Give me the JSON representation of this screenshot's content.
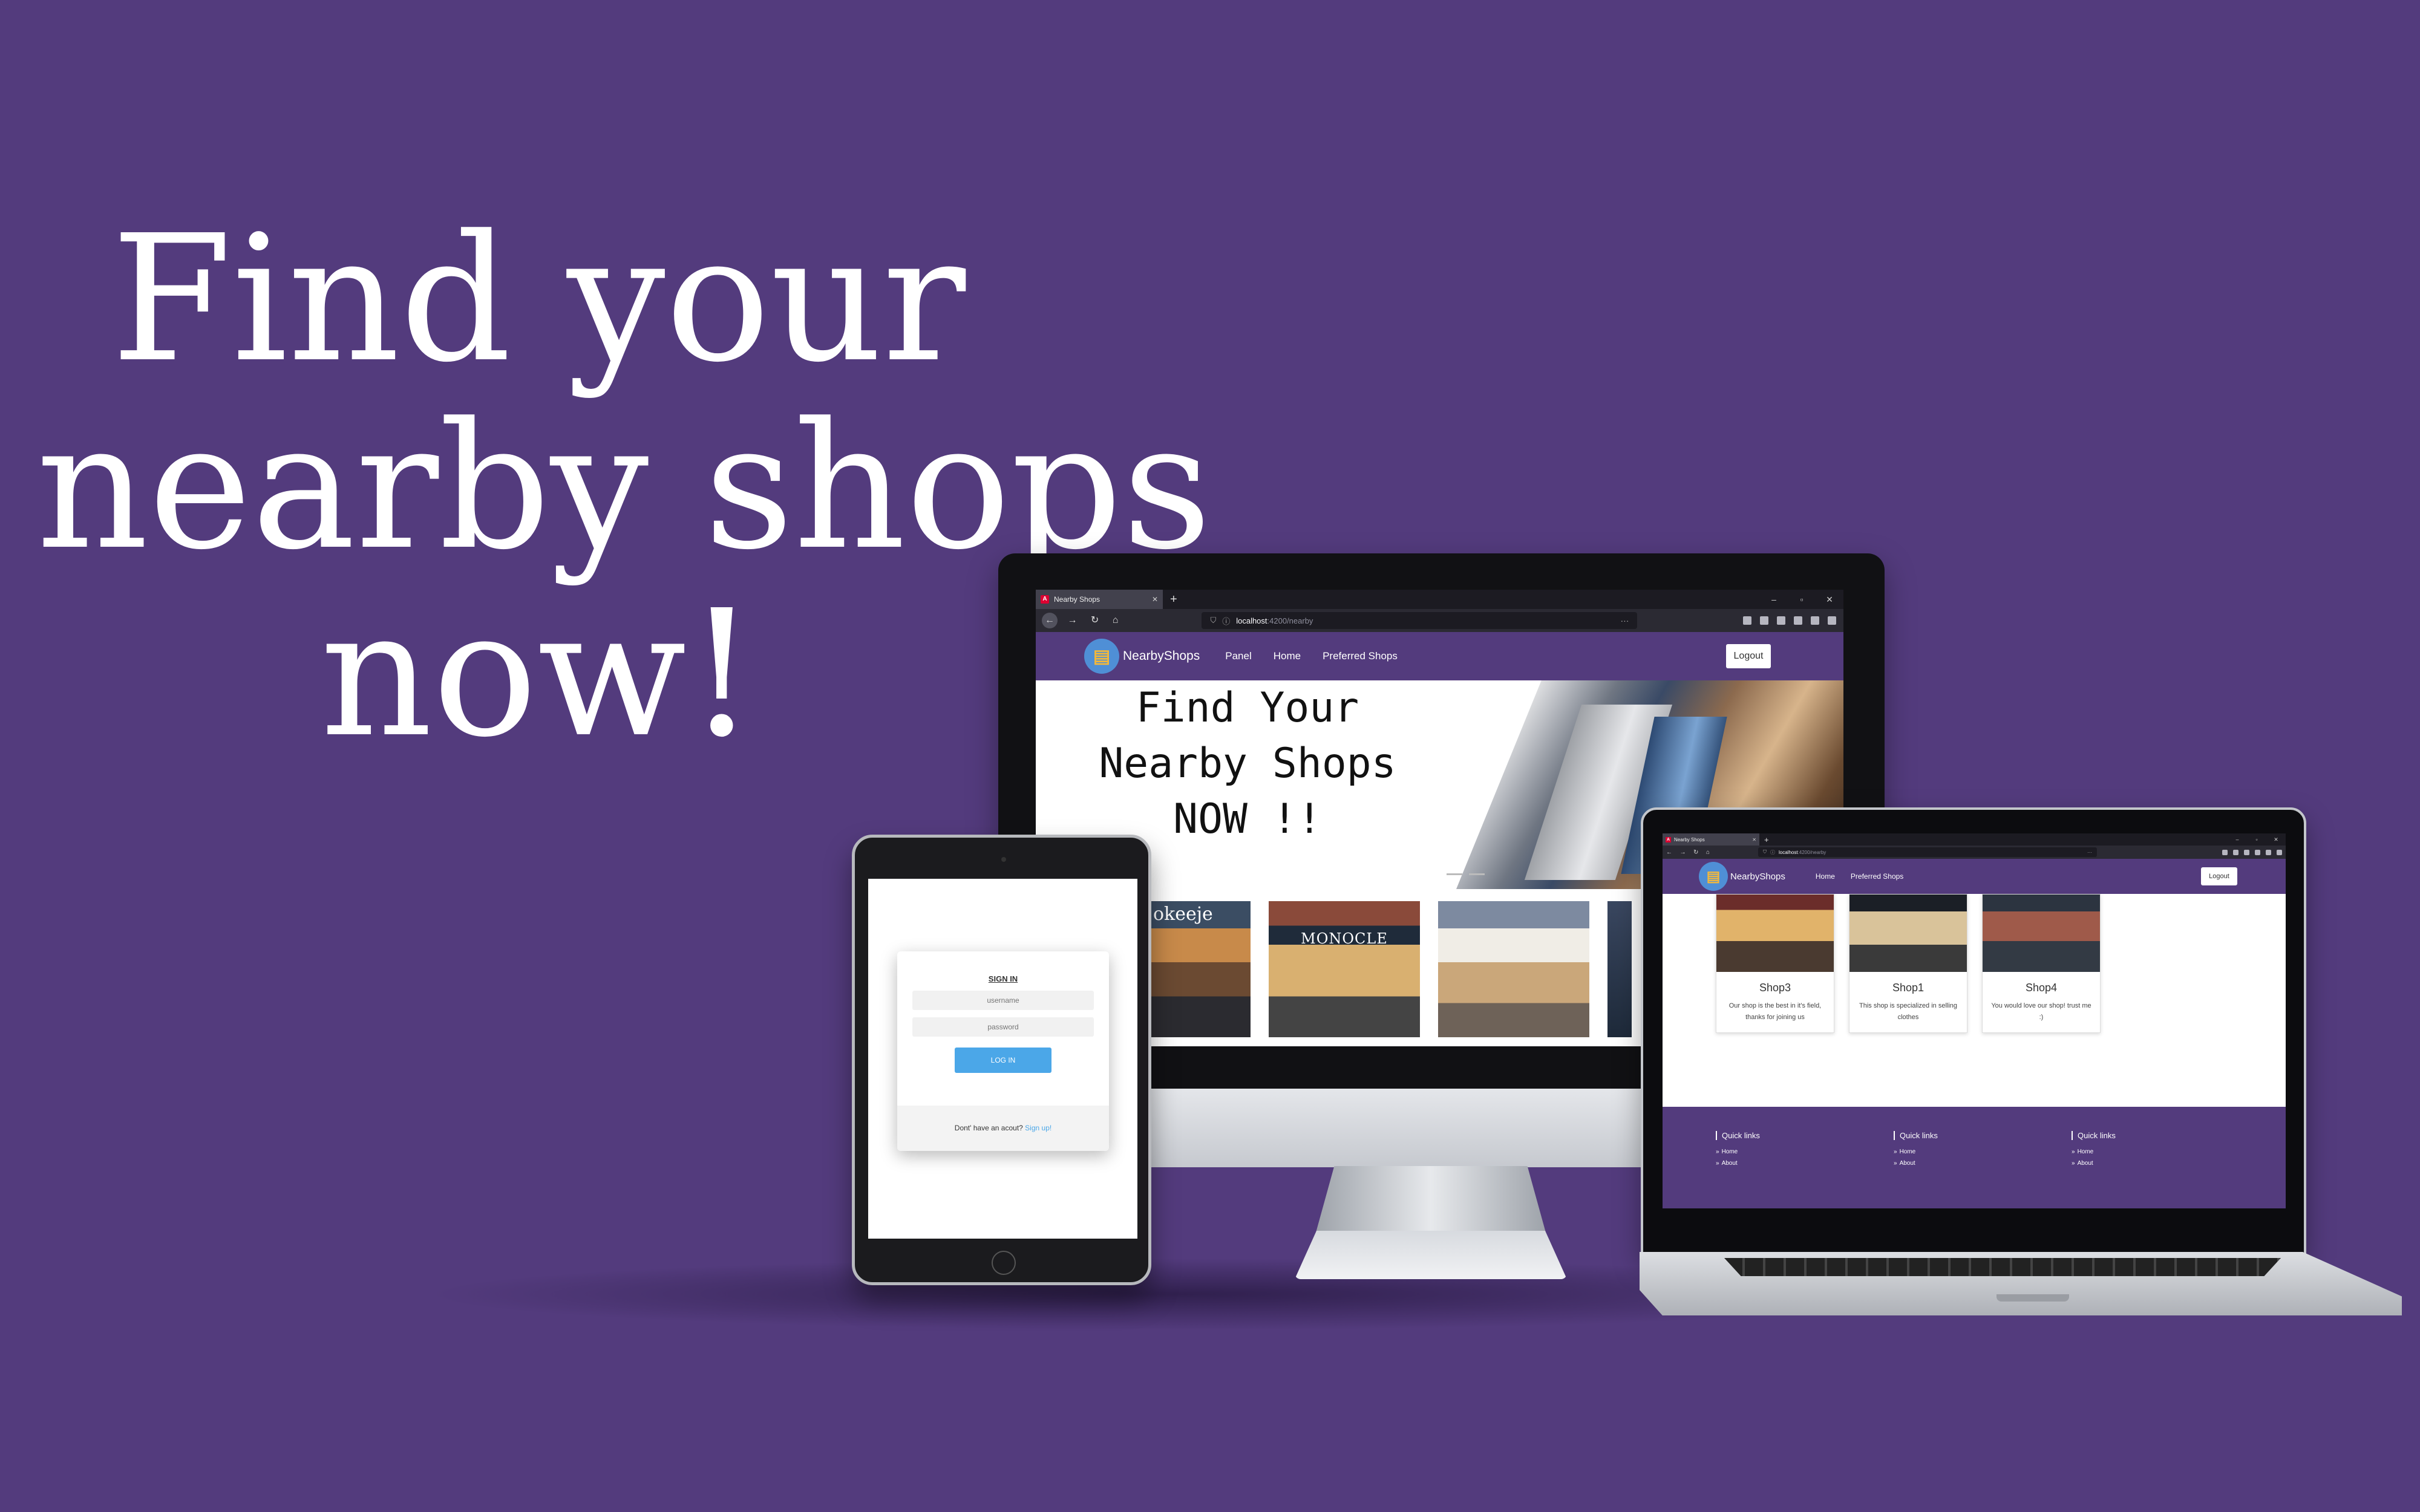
{
  "headline": [
    "Find your",
    "nearby shops",
    "now!"
  ],
  "colors": {
    "background": "#533b7d",
    "navbar": "#533b7d",
    "accent_blue": "#4ba7e8"
  },
  "browser": {
    "tab_title": "Nearby Shops",
    "new_tab_icon": "plus-icon",
    "url_host": "localhost",
    "url_path": ":4200/nearby",
    "url_menu": "···",
    "window_controls": [
      "–",
      "▫",
      "✕"
    ]
  },
  "navbar": {
    "brand": "NearbyShops",
    "logo_icon": "storefront-icon",
    "desktop_links": [
      "Panel",
      "Home",
      "Preferred Shops"
    ],
    "laptop_links": [
      "Home",
      "Preferred Shops"
    ],
    "logout": "Logout"
  },
  "hero": {
    "lines": [
      "Find Your",
      "Nearby Shops",
      "NOW !!"
    ]
  },
  "shop_strip": {
    "signs": [
      "okeeje",
      "MONOCLE"
    ]
  },
  "login": {
    "title": "SIGN IN",
    "username_placeholder": "username",
    "password_placeholder": "password",
    "button": "LOG IN",
    "footer_text": "Dont' have an acout?",
    "signup_link": "Sign up!"
  },
  "shops": [
    {
      "name": "Shop3",
      "description": "Our shop is the best in it's field, thanks for joining us"
    },
    {
      "name": "Shop1",
      "description": "This shop is specialized in selling clothes"
    },
    {
      "name": "Shop4",
      "description": "You would love our shop! trust me :)"
    }
  ],
  "footer": {
    "columns": [
      {
        "heading": "Quick links",
        "links": [
          "Home",
          "About"
        ]
      },
      {
        "heading": "Quick links",
        "links": [
          "Home",
          "About"
        ]
      },
      {
        "heading": "Quick links",
        "links": [
          "Home",
          "About"
        ]
      }
    ]
  }
}
